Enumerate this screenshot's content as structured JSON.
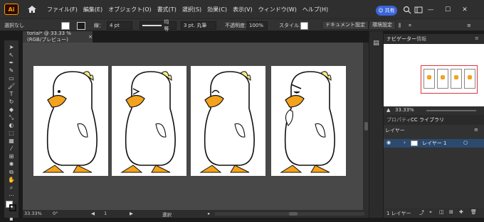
{
  "menubar": {
    "app_logo": "Ai",
    "items": [
      "ファイル(F)",
      "編集(E)",
      "オブジェクト(O)",
      "書式(T)",
      "選択(S)",
      "効果(C)",
      "表示(V)",
      "ウィンドウ(W)",
      "ヘルプ(H)"
    ],
    "share_label": "共有"
  },
  "controlbar": {
    "selection_status": "選択なし",
    "stroke_label": "線：",
    "stroke_value": "4 pt",
    "line_style": "均等",
    "brush_value": "3 pt. 丸筆",
    "opacity_label": "不透明度：",
    "opacity_value": "100%",
    "style_label": "スタイル：",
    "doc_settings": "ドキュメント設定",
    "env_settings": "環境設定"
  },
  "document": {
    "tab_title": "toriai* @ 33.33 % (RGB/プレビュー)",
    "close": "×"
  },
  "statusbar": {
    "zoom": "33.33%",
    "rotation": "0°",
    "artboard_number": "1",
    "tool_status": "選択"
  },
  "panels": {
    "navigator_tab": "ナビゲーター",
    "info_tab": "情報",
    "nav_zoom": "33.33%",
    "properties_tab": "プロパティ",
    "cc_library_tab": "CC ライブラリ",
    "layers_tab": "レイヤー",
    "layer_name": "レイヤー 1",
    "layer_count": "1 レイヤー"
  },
  "colors": {
    "accent": "#3b64d8",
    "app_orange": "#ff9a00",
    "artboard_bg": "#ffffff",
    "canvas_bg": "#484848",
    "beak": "#f3a21b",
    "layer_selected": "#2c4a6e"
  },
  "artboards": [
    {
      "expression": "normal"
    },
    {
      "expression": "squint"
    },
    {
      "expression": "happy"
    },
    {
      "expression": "angry"
    }
  ]
}
